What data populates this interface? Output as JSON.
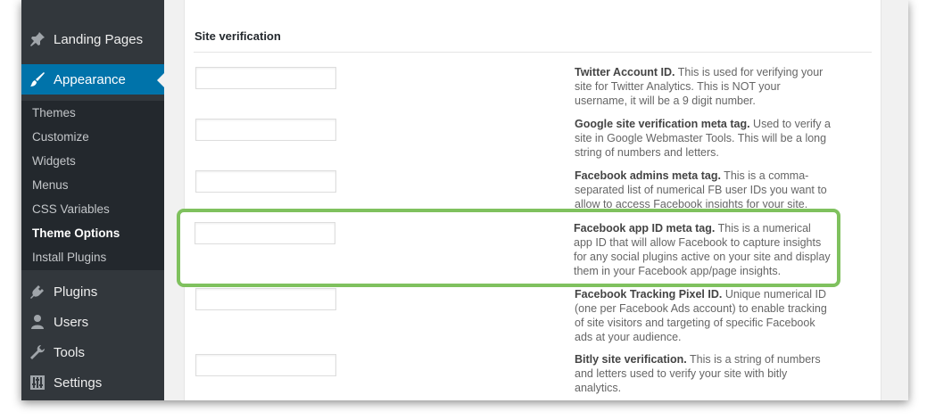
{
  "sidebar": {
    "landing_pages": "Landing Pages",
    "appearance": "Appearance",
    "submenu": [
      "Themes",
      "Customize",
      "Widgets",
      "Menus",
      "CSS Variables",
      "Theme Options",
      "Install Plugins"
    ],
    "active_submenu": "Theme Options",
    "plugins": "Plugins",
    "users": "Users",
    "tools": "Tools",
    "settings": "Settings"
  },
  "section": {
    "title": "Site verification"
  },
  "fields": [
    {
      "name": "Twitter Account ID.",
      "desc": " This is used for verifying your site for Twitter Analytics. This is NOT your username, it will be a 9 digit number.",
      "value": ""
    },
    {
      "name": "Google site verification meta tag.",
      "desc": " Used to verify a site in Google Webmaster Tools. This will be a long string of numbers and letters.",
      "value": ""
    },
    {
      "name": "Facebook admins meta tag.",
      "desc": " This is a comma-separated list of numerical FB user IDs you want to allow to access Facebook insights for your site.",
      "value": ""
    },
    {
      "name": "Facebook app ID meta tag.",
      "desc": " This is a numerical app ID that will allow Facebook to capture insights for any social plugins active on your site and display them in your Facebook app/page insights.",
      "value": ""
    },
    {
      "name": "Facebook Tracking Pixel ID.",
      "desc": " Unique numerical ID (one per Facebook Ads account) to enable tracking of site visitors and targeting of specific Facebook ads at your audience.",
      "value": ""
    },
    {
      "name": "Bitly site verification.",
      "desc": " This is a string of numbers and letters used to verify your site with bitly analytics.",
      "value": ""
    }
  ],
  "colors": {
    "sidebar_bg": "#32373c",
    "submenu_bg": "#23282d",
    "current_menu_bg": "#0073aa",
    "highlight_border": "#7fc15e"
  },
  "icons": {
    "landing_pages": "pushpin-icon",
    "appearance": "paintbrush-icon",
    "plugins": "plug-icon",
    "users": "user-icon",
    "tools": "wrench-icon",
    "settings": "sliders-icon"
  }
}
